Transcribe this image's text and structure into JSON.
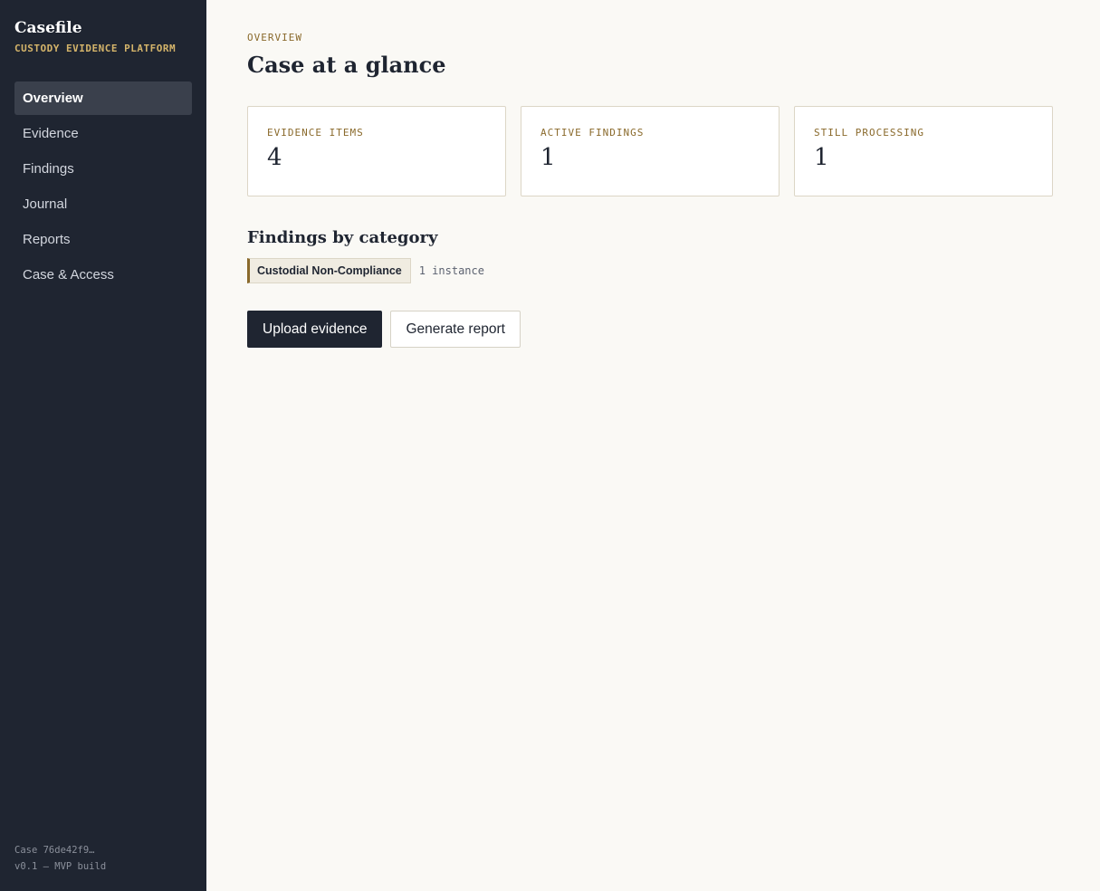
{
  "sidebar": {
    "brand_title": "Casefile",
    "brand_subtitle": "CUSTODY EVIDENCE PLATFORM",
    "nav": [
      {
        "label": "Overview",
        "active": true
      },
      {
        "label": "Evidence",
        "active": false
      },
      {
        "label": "Findings",
        "active": false
      },
      {
        "label": "Journal",
        "active": false
      },
      {
        "label": "Reports",
        "active": false
      },
      {
        "label": "Case & Access",
        "active": false
      }
    ],
    "footer_case": "Case 76de42f9…",
    "footer_version": "v0.1 — MVP build"
  },
  "main": {
    "eyebrow": "OVERVIEW",
    "title": "Case at a glance",
    "stats": [
      {
        "label": "EVIDENCE ITEMS",
        "value": "4"
      },
      {
        "label": "ACTIVE FINDINGS",
        "value": "1"
      },
      {
        "label": "STILL PROCESSING",
        "value": "1"
      }
    ],
    "findings_section_title": "Findings by category",
    "categories": [
      {
        "name": "Custodial Non-Compliance",
        "count": "1 instance"
      }
    ],
    "actions": {
      "upload_label": "Upload evidence",
      "report_label": "Generate report"
    }
  },
  "colors": {
    "sidebar_bg": "#1f2531",
    "accent_gold": "#d4b46a",
    "accent_brown": "#8a6a2c",
    "page_bg": "#faf9f5"
  }
}
